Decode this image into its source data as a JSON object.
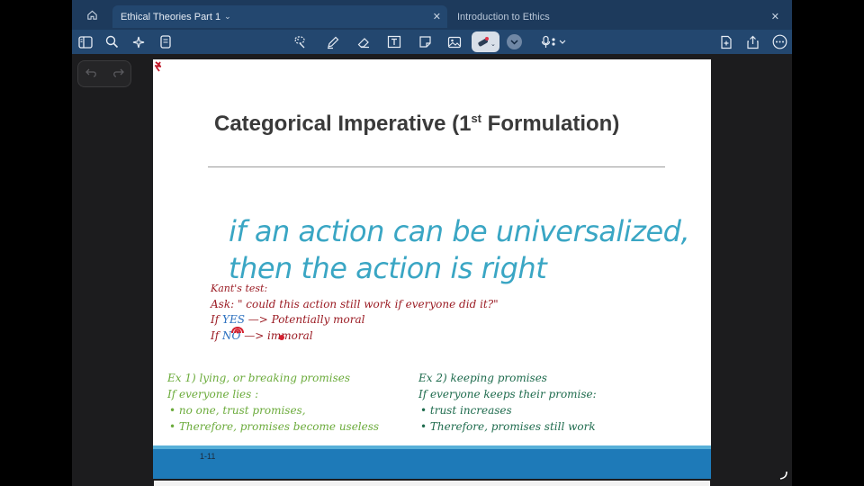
{
  "tabs": [
    {
      "label": "Ethical Theories Part 1",
      "active": true
    },
    {
      "label": "Introduction to Ethics",
      "active": false
    }
  ],
  "toolbar": {
    "icons": [
      "sidebar-icon",
      "search-icon",
      "sparkle-icon",
      "document-icon",
      "lasso-icon",
      "pen-icon",
      "eraser-icon",
      "text-box-icon",
      "sticky-note-icon",
      "image-icon",
      "laser-pointer-icon",
      "chevron-down-icon",
      "microphone-icon",
      "add-page-icon",
      "share-icon",
      "more-icon"
    ]
  },
  "slide": {
    "title_main": "Categorical Imperative (1",
    "title_sup": "st",
    "title_end": " Formulation)",
    "quote_line1": "if an action can be universalized,",
    "quote_line2": "then the action is right",
    "notes": {
      "kant_test": "Kant's test:",
      "ask": "Ask: \" could this action still work if everyone did it?\"",
      "if1": "If",
      "yes": "YES",
      "arrow1": "—> Potentially moral",
      "if2": "If",
      "no": "NO",
      "arrow2": "—> immoral"
    },
    "ex1": {
      "title": "Ex 1) lying, or breaking promises",
      "line1": "If everyone lies :",
      "bullet1": "• no one, trust promises,",
      "bullet2": "• Therefore, promises become useless"
    },
    "ex2": {
      "title": "Ex 2) keeping promises",
      "line1": "If everyone keeps their promise:",
      "bullet1": "• trust increases",
      "bullet2": "• Therefore, promises still work"
    },
    "page_number": "1-11"
  },
  "colors": {
    "tab_bar": "#1d3a5c",
    "toolbar": "#23476f",
    "quote": "#3aa6c4",
    "red_ink": "#9b1c24",
    "blue_ink": "#2a6fbf",
    "green_ink": "#6bab3b",
    "dark_green_ink": "#1e6b4d",
    "footer": "#1e7ab8"
  }
}
